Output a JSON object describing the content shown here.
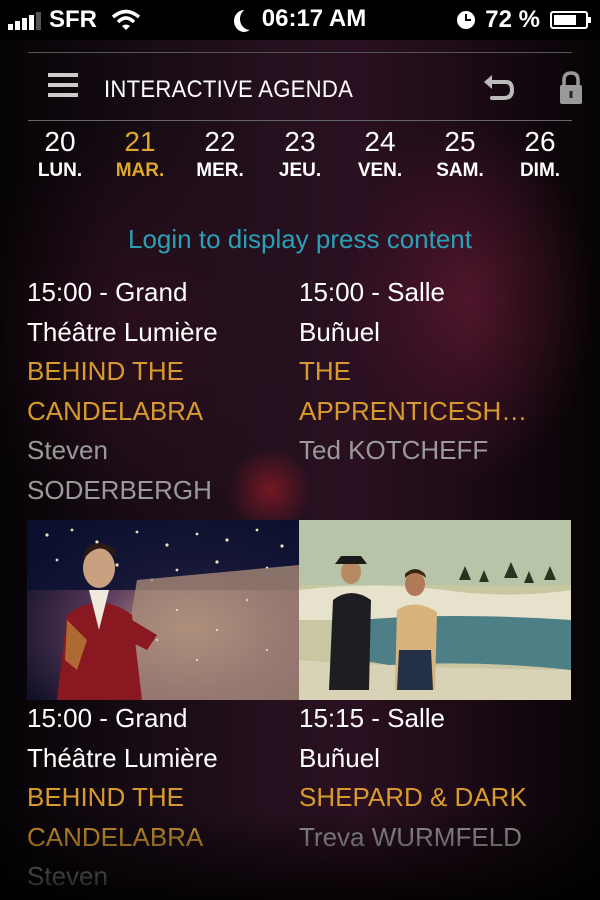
{
  "status_bar": {
    "carrier": "SFR",
    "time": "06:17 AM",
    "battery": "72 %",
    "battery_level": 0.72
  },
  "header": {
    "title": "INTERACTIVE AGENDA"
  },
  "days": [
    {
      "num": "20",
      "dow": "LUN.",
      "active": false
    },
    {
      "num": "21",
      "dow": "MAR.",
      "active": true
    },
    {
      "num": "22",
      "dow": "MER.",
      "active": false
    },
    {
      "num": "23",
      "dow": "JEU.",
      "active": false
    },
    {
      "num": "24",
      "dow": "VEN.",
      "active": false
    },
    {
      "num": "25",
      "dow": "SAM.",
      "active": false
    },
    {
      "num": "26",
      "dow": "DIM.",
      "active": false
    }
  ],
  "login_prompt": "Login to display press content",
  "events": [
    {
      "time_line1": "15:00 - Grand",
      "time_line2": "Théâtre Lumière",
      "film_line1": "BEHIND THE",
      "film_line2": "CANDELABRA",
      "director_line1": "Steven",
      "director_line2": "SODERBERGH"
    },
    {
      "time_line1": "15:00 - Salle",
      "time_line2": "Buñuel",
      "film_line1": "THE",
      "film_line2": "APPRENTICESH…",
      "director_line1": "Ted KOTCHEFF"
    },
    {
      "time_line1": "15:00 - Grand",
      "time_line2": "Théâtre Lumière",
      "film_line1": "BEHIND THE",
      "film_line2": "CANDELABRA",
      "director_line1": "Steven"
    },
    {
      "time_line1": "15:15 - Salle",
      "time_line2": "Buñuel",
      "film_line1": "SHEPARD & DARK",
      "director_line1": "Treva WURMFELD"
    }
  ],
  "colors": {
    "accent_gold": "#e0a82b",
    "film_title": "#d89a2c",
    "login_link": "#2aa0b8",
    "director": "#9a9a9a"
  },
  "icons": [
    "menu-icon",
    "undo-icon",
    "lock-icon",
    "signal-icon",
    "wifi-icon",
    "moon-icon",
    "clock-icon",
    "battery-icon"
  ]
}
